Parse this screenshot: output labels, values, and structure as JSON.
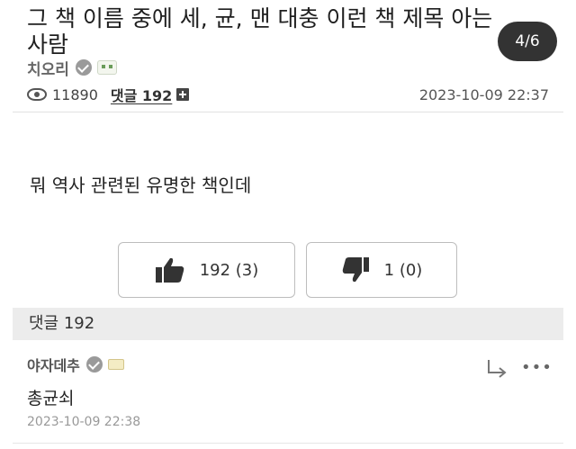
{
  "post": {
    "title": "그 책 이름 중에 세, 균, 맨 대충 이런 책 제목 아는 사람",
    "page_indicator": "4/6",
    "author": "치오리",
    "views": "11890",
    "comments_label": "댓글 192",
    "date": "2023-10-09 22:37",
    "body": "뭐 역사 관련된 유명한 책인데"
  },
  "votes": {
    "up": "192 (3)",
    "down": "1 (0)"
  },
  "comments_section": {
    "header": "댓글 192",
    "items": [
      {
        "author": "야자데추",
        "text": "총균쇠",
        "date": "2023-10-09 22:38"
      }
    ]
  },
  "icons": {
    "views": "eye-icon",
    "add": "plus-box-icon",
    "thumbs_up": "thumbs-up-icon",
    "thumbs_down": "thumbs-down-icon",
    "reply": "reply-arrow-icon",
    "more": "more-dots-icon"
  }
}
